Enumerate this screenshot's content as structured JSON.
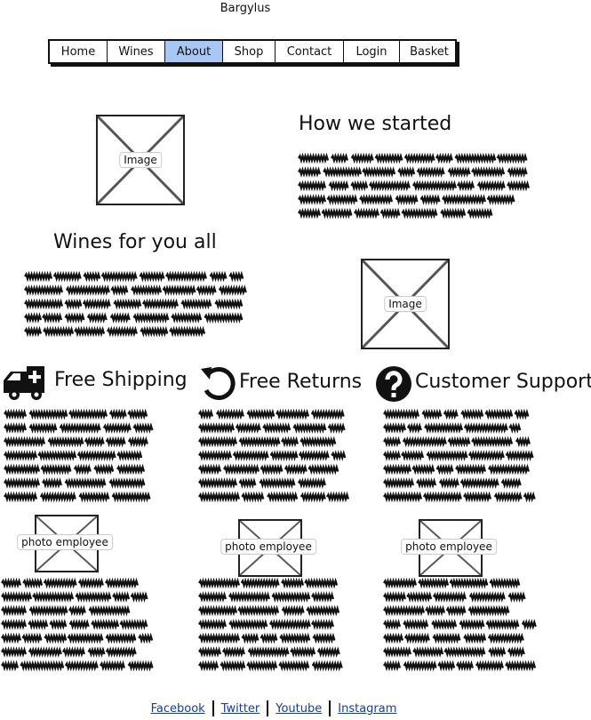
{
  "site": {
    "title": "Bargylus"
  },
  "nav": {
    "items": [
      {
        "label": "Home"
      },
      {
        "label": "Wines"
      },
      {
        "label": "About"
      },
      {
        "label": "Shop"
      },
      {
        "label": "Contact"
      },
      {
        "label": "Login"
      },
      {
        "label": "Basket"
      }
    ],
    "active_index": 2,
    "active_color": "#a9c7f4"
  },
  "sections": {
    "started": {
      "heading": "How we started",
      "image_label": "Image"
    },
    "wines": {
      "heading": "Wines for you all",
      "image_label": "Image"
    }
  },
  "features": [
    {
      "title": "Free Shipping",
      "icon": "ambulance-icon",
      "photo_label": "photo employee"
    },
    {
      "title": "Free Returns",
      "icon": "undo-icon",
      "photo_label": "photo employee"
    },
    {
      "title": "Customer Support",
      "icon": "question-circle-icon",
      "photo_label": "photo employee"
    }
  ],
  "footer": {
    "links": [
      {
        "label": "Facebook"
      },
      {
        "label": "Twitter"
      },
      {
        "label": "Youtube"
      },
      {
        "label": "Instagram"
      }
    ]
  }
}
